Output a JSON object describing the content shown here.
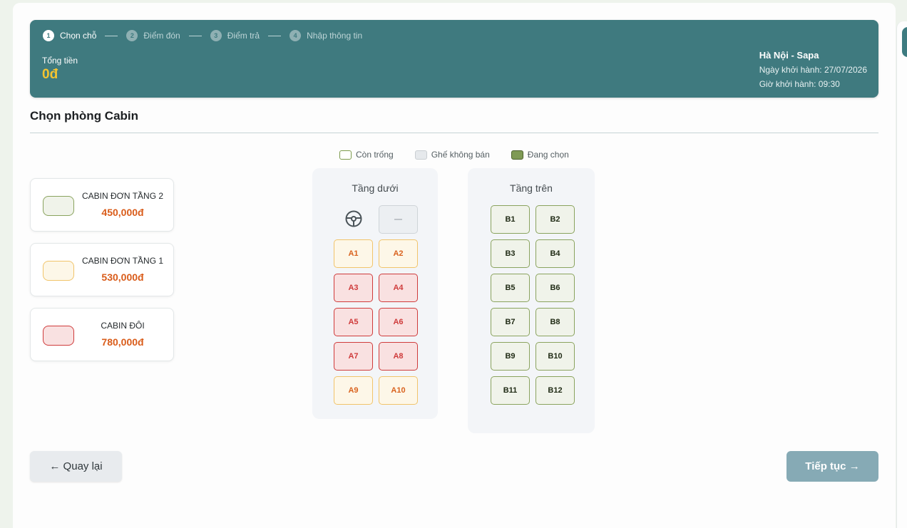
{
  "steps": [
    {
      "num": "1",
      "label": "Chọn chỗ"
    },
    {
      "num": "2",
      "label": "Điểm đón"
    },
    {
      "num": "3",
      "label": "Điểm trả"
    },
    {
      "num": "4",
      "label": "Nhập thông tin"
    }
  ],
  "summary": {
    "total_label": "Tổng tiền",
    "total_value": "0đ",
    "route": "Hà Nội - Sapa",
    "departure_date": "Ngày khởi hành: 27/07/2026",
    "departure_time": "Giờ khởi hành: 09:30"
  },
  "section_title": "Chọn phòng Cabin",
  "legend": [
    {
      "label": "Còn trống"
    },
    {
      "label": "Ghế không bán"
    },
    {
      "label": "Đang chọn"
    }
  ],
  "cabin_types": [
    {
      "name": "CABIN ĐƠN TẦNG 2",
      "price": "450,000đ",
      "color": "#8aa35e"
    },
    {
      "name": "CABIN ĐƠN TẦNG 1",
      "price": "530,000đ",
      "color": "#f1c46a"
    },
    {
      "name": "CABIN ĐÔI",
      "price": "780,000đ",
      "color": "#cf3b3b"
    }
  ],
  "lower_deck": {
    "title": "Tầng dưới",
    "driver_seat_label": "—",
    "seats": [
      "A1",
      "A2",
      "A3",
      "A4",
      "A5",
      "A6",
      "A7",
      "A8",
      "A9",
      "A10"
    ]
  },
  "upper_deck": {
    "title": "Tầng trên",
    "seats": [
      "B1",
      "B2",
      "B3",
      "B4",
      "B5",
      "B6",
      "B7",
      "B8",
      "B9",
      "B10",
      "B11",
      "B12"
    ]
  },
  "buttons": {
    "back": "← Quay lại",
    "next": "Tiếp tục →"
  },
  "colors": {
    "header_bg": "#3f7a7f",
    "total_value": "#f4c430",
    "price_text": "#d95c1a",
    "next_button": "#86aab5"
  },
  "icons": {
    "driver": "steering-wheel-icon"
  }
}
